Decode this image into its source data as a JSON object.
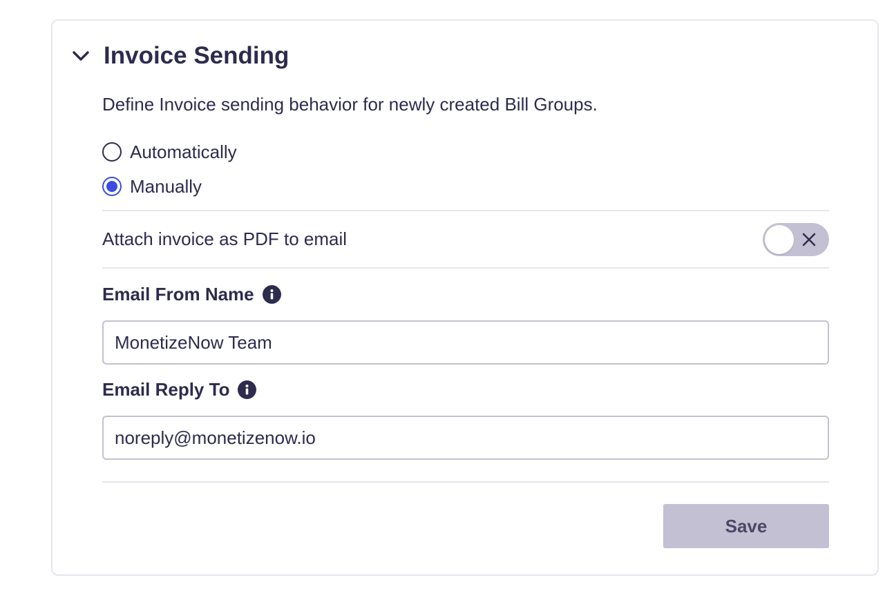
{
  "section": {
    "title": "Invoice Sending",
    "description": "Define Invoice sending behavior for newly created Bill Groups."
  },
  "sending_mode": {
    "options": [
      {
        "label": "Automatically",
        "selected": false
      },
      {
        "label": "Manually",
        "selected": true
      }
    ]
  },
  "attach_pdf": {
    "label": "Attach invoice as PDF to email",
    "enabled": false
  },
  "email_from_name": {
    "label": "Email From Name",
    "value": "MonetizeNow Team"
  },
  "email_reply_to": {
    "label": "Email Reply To",
    "value": "noreply@monetizenow.io"
  },
  "actions": {
    "save_label": "Save"
  },
  "colors": {
    "text": "#2d2b4e",
    "accent": "#3b4de0",
    "disabled": "#c4c0d3",
    "border": "#e6e5ec"
  }
}
